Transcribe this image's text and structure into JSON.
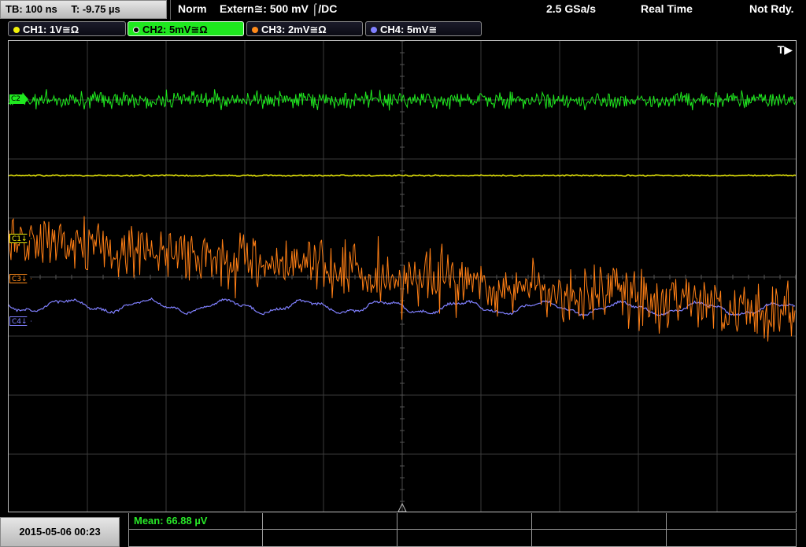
{
  "statusbar": {
    "timebase": "TB: 100 ns",
    "trigger_pos": "T: -9.75 µs",
    "acq_mode": "Norm",
    "trigger_source": "Extern≅: 500 mV ⌠/DC",
    "sample_rate": "2.5 GSa/s",
    "mode": "Real Time",
    "state": "Not Rdy."
  },
  "channels": [
    {
      "label": "CH1: 1V≅Ω",
      "color": "#f2f20a",
      "active": false
    },
    {
      "label": "CH2: 5mV≅Ω",
      "color": "#1fe81f",
      "active": true
    },
    {
      "label": "CH3: 2mV≅Ω",
      "color": "#ff8a1a",
      "active": false
    },
    {
      "label": "CH4: 5mV≅",
      "color": "#8080ff",
      "active": false
    }
  ],
  "markers": {
    "trigger": "T▶",
    "c1": "C1↓",
    "c3": "C3↓",
    "c4": "C4↓",
    "c2": "C2"
  },
  "footer": {
    "datetime": "2015-05-06 00:23",
    "measurement": "Mean: 66.88 µV"
  },
  "trace_colors": {
    "ch1": "#f2f20a",
    "ch2": "#1fe81f",
    "ch3": "#ff7f15",
    "ch4": "#8080ff"
  }
}
